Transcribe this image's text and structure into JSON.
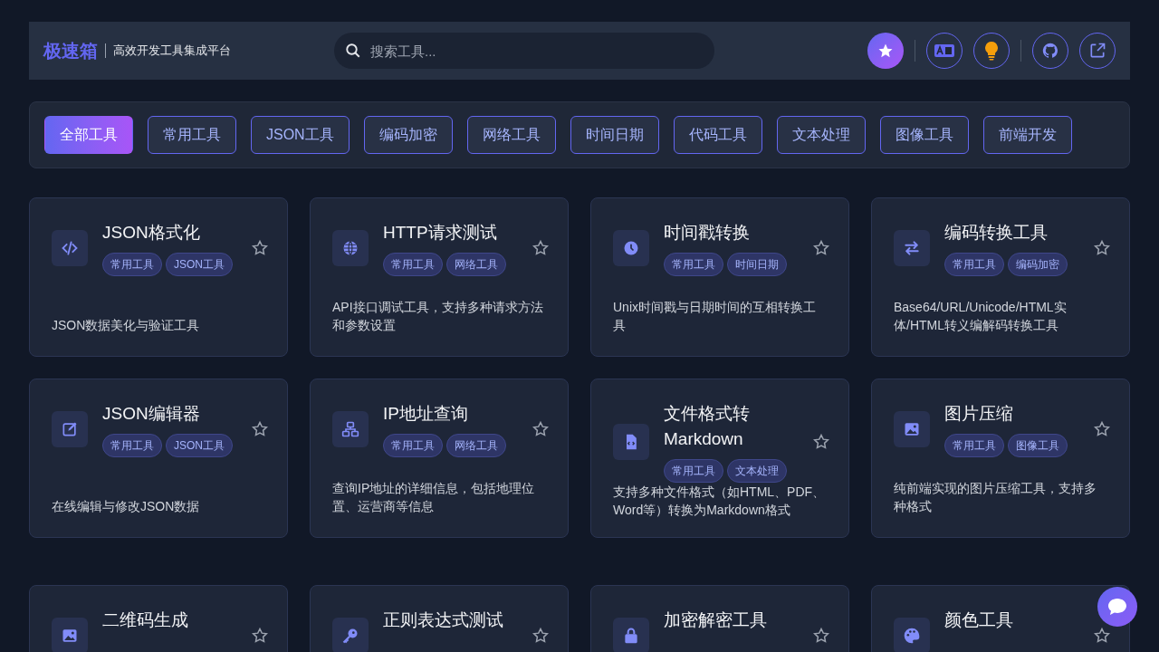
{
  "header": {
    "logo": "极速箱",
    "tagline": "高效开发工具集成平台",
    "search": {
      "placeholder": "搜索工具..."
    }
  },
  "categories": [
    {
      "label": "全部工具",
      "selected": true
    },
    {
      "label": "常用工具",
      "selected": false
    },
    {
      "label": "JSON工具",
      "selected": false
    },
    {
      "label": "编码加密",
      "selected": false
    },
    {
      "label": "网络工具",
      "selected": false
    },
    {
      "label": "时间日期",
      "selected": false
    },
    {
      "label": "代码工具",
      "selected": false
    },
    {
      "label": "文本处理",
      "selected": false
    },
    {
      "label": "图像工具",
      "selected": false
    },
    {
      "label": "前端开发",
      "selected": false
    }
  ],
  "tools": [
    {
      "title": "JSON格式化",
      "tags": [
        "常用工具",
        "JSON工具"
      ],
      "description": "JSON数据美化与验证工具"
    },
    {
      "title": "HTTP请求测试",
      "tags": [
        "常用工具",
        "网络工具"
      ],
      "description": "API接口调试工具，支持多种请求方法和参数设置"
    },
    {
      "title": "时间戳转换",
      "tags": [
        "常用工具",
        "时间日期"
      ],
      "description": "Unix时间戳与日期时间的互相转换工具"
    },
    {
      "title": "编码转换工具",
      "tags": [
        "常用工具",
        "编码加密"
      ],
      "description": "Base64/URL/Unicode/HTML实体/HTML转义编解码转换工具"
    },
    {
      "title": "JSON编辑器",
      "tags": [
        "常用工具",
        "JSON工具"
      ],
      "description": "在线编辑与修改JSON数据"
    },
    {
      "title": "IP地址查询",
      "tags": [
        "常用工具",
        "网络工具"
      ],
      "description": "查询IP地址的详细信息，包括地理位置、运营商等信息"
    },
    {
      "title": "文件格式转Markdown",
      "tags": [
        "常用工具",
        "文本处理"
      ],
      "description": "支持多种文件格式（如HTML、PDF、Word等）转换为Markdown格式"
    },
    {
      "title": "图片压缩",
      "tags": [
        "常用工具",
        "图像工具"
      ],
      "description": "纯前端实现的图片压缩工具，支持多种格式"
    },
    {
      "title": "二维码生成"
    },
    {
      "title": "正则表达式测试"
    },
    {
      "title": "加密解密工具"
    },
    {
      "title": "颜色工具"
    }
  ]
}
